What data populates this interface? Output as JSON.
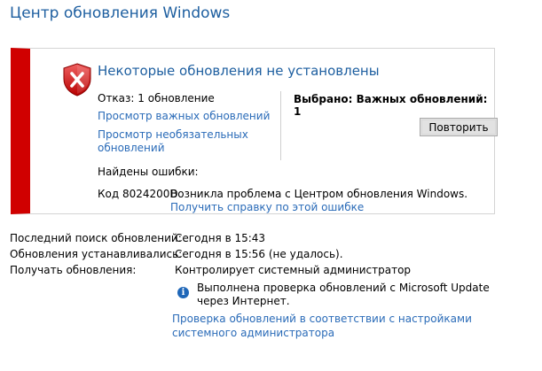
{
  "window": {
    "title": "Центр обновления Windows"
  },
  "status_panel": {
    "heading": "Некоторые обновления не установлены",
    "fail_text": "Отказ: 1 обновление",
    "link_important": "Просмотр важных обновлений",
    "link_optional": "Просмотр необязательных обновлений",
    "selected_text": "Выбрано: Важных обновлений: 1",
    "retry_label": "Повторить",
    "errors_found": "Найдены ошибки:",
    "error_code": "Код 8024200D",
    "error_description": "Возникла проблема с Центром обновления Windows.",
    "error_help_link": "Получить справку по этой ошибке",
    "accent_color": "#d00000",
    "icon": "error-shield-icon"
  },
  "info": {
    "last_check_label": "Последний поиск обновлений:",
    "last_check_value": "Сегодня в 15:43",
    "installed_label": "Обновления устанавливались:",
    "installed_value": "Сегодня в 15:56 (не удалось).",
    "receive_label": "Получать обновления:",
    "receive_value": "Контролирует системный администратор",
    "note": "Выполнена проверка обновлений с Microsoft Update через Интернет.",
    "note_icon": "info-icon",
    "policy_link": "Проверка обновлений в соответствии с настройками системного администратора"
  },
  "colors": {
    "title": "#1e5fa0",
    "link": "#2a6bb8",
    "error_bar": "#d00000"
  }
}
